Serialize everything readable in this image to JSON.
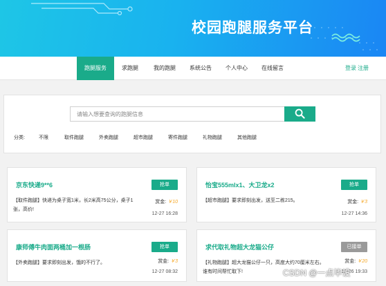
{
  "banner": {
    "title": "校园跑腿服务平台"
  },
  "nav": {
    "items": [
      {
        "label": "跑腿服务",
        "active": true
      },
      {
        "label": "求跑腿"
      },
      {
        "label": "我的跑腿"
      },
      {
        "label": "系统公告"
      },
      {
        "label": "个人中心"
      },
      {
        "label": "在线留言"
      }
    ],
    "login_label": "登录",
    "register_label": "注册"
  },
  "search": {
    "placeholder": "请输入想要查询的跑腿信息",
    "value": ""
  },
  "filters": {
    "label": "分类:",
    "options": [
      "不限",
      "取件跑腿",
      "外卖跑腿",
      "超市跑腿",
      "寄件跑腿",
      "礼物跑腿",
      "其他跑腿"
    ]
  },
  "cards": [
    {
      "title": "京东快递9**6",
      "badge": "抢单",
      "desc": "【取件跑腿】快递为桌子宽1米，长2米高75公分，桌子1张，高价!",
      "reward_label": "赏金:",
      "reward": "￥10",
      "time": "12-27 16:28"
    },
    {
      "title": "怡宝555mlx1、大卫龙x2",
      "badge": "抢单",
      "desc": "【超市跑腿】要求即刻出发，送至二栋215。",
      "reward_label": "赏金:",
      "reward": "￥3",
      "time": "12-27 14:36"
    },
    {
      "title": "康师傅牛肉面两桶加一根肠",
      "badge": "抢单",
      "desc": "【外卖跑腿】要求即刻出发，饿的不行了。",
      "reward_label": "赏金:",
      "reward": "￥3",
      "time": "12-27 08:32"
    },
    {
      "title": "求代取礼物超大龙猫公仔",
      "badge": "已接单",
      "done": true,
      "desc": "【礼物跑腿】超大龙猫公仔一只，高度大约70厘米左右。谁有时间帮忙取下!",
      "reward_label": "赏金:",
      "reward": "￥20",
      "time": "12-26 19:33"
    }
  ],
  "watermark": "CSDN @一点毕设",
  "colors": {
    "accent": "#1aab8a",
    "banner_start": "#1ec6e6",
    "banner_end": "#1a86f4",
    "reward": "#f5a623",
    "done_badge": "#9a9a9a"
  }
}
